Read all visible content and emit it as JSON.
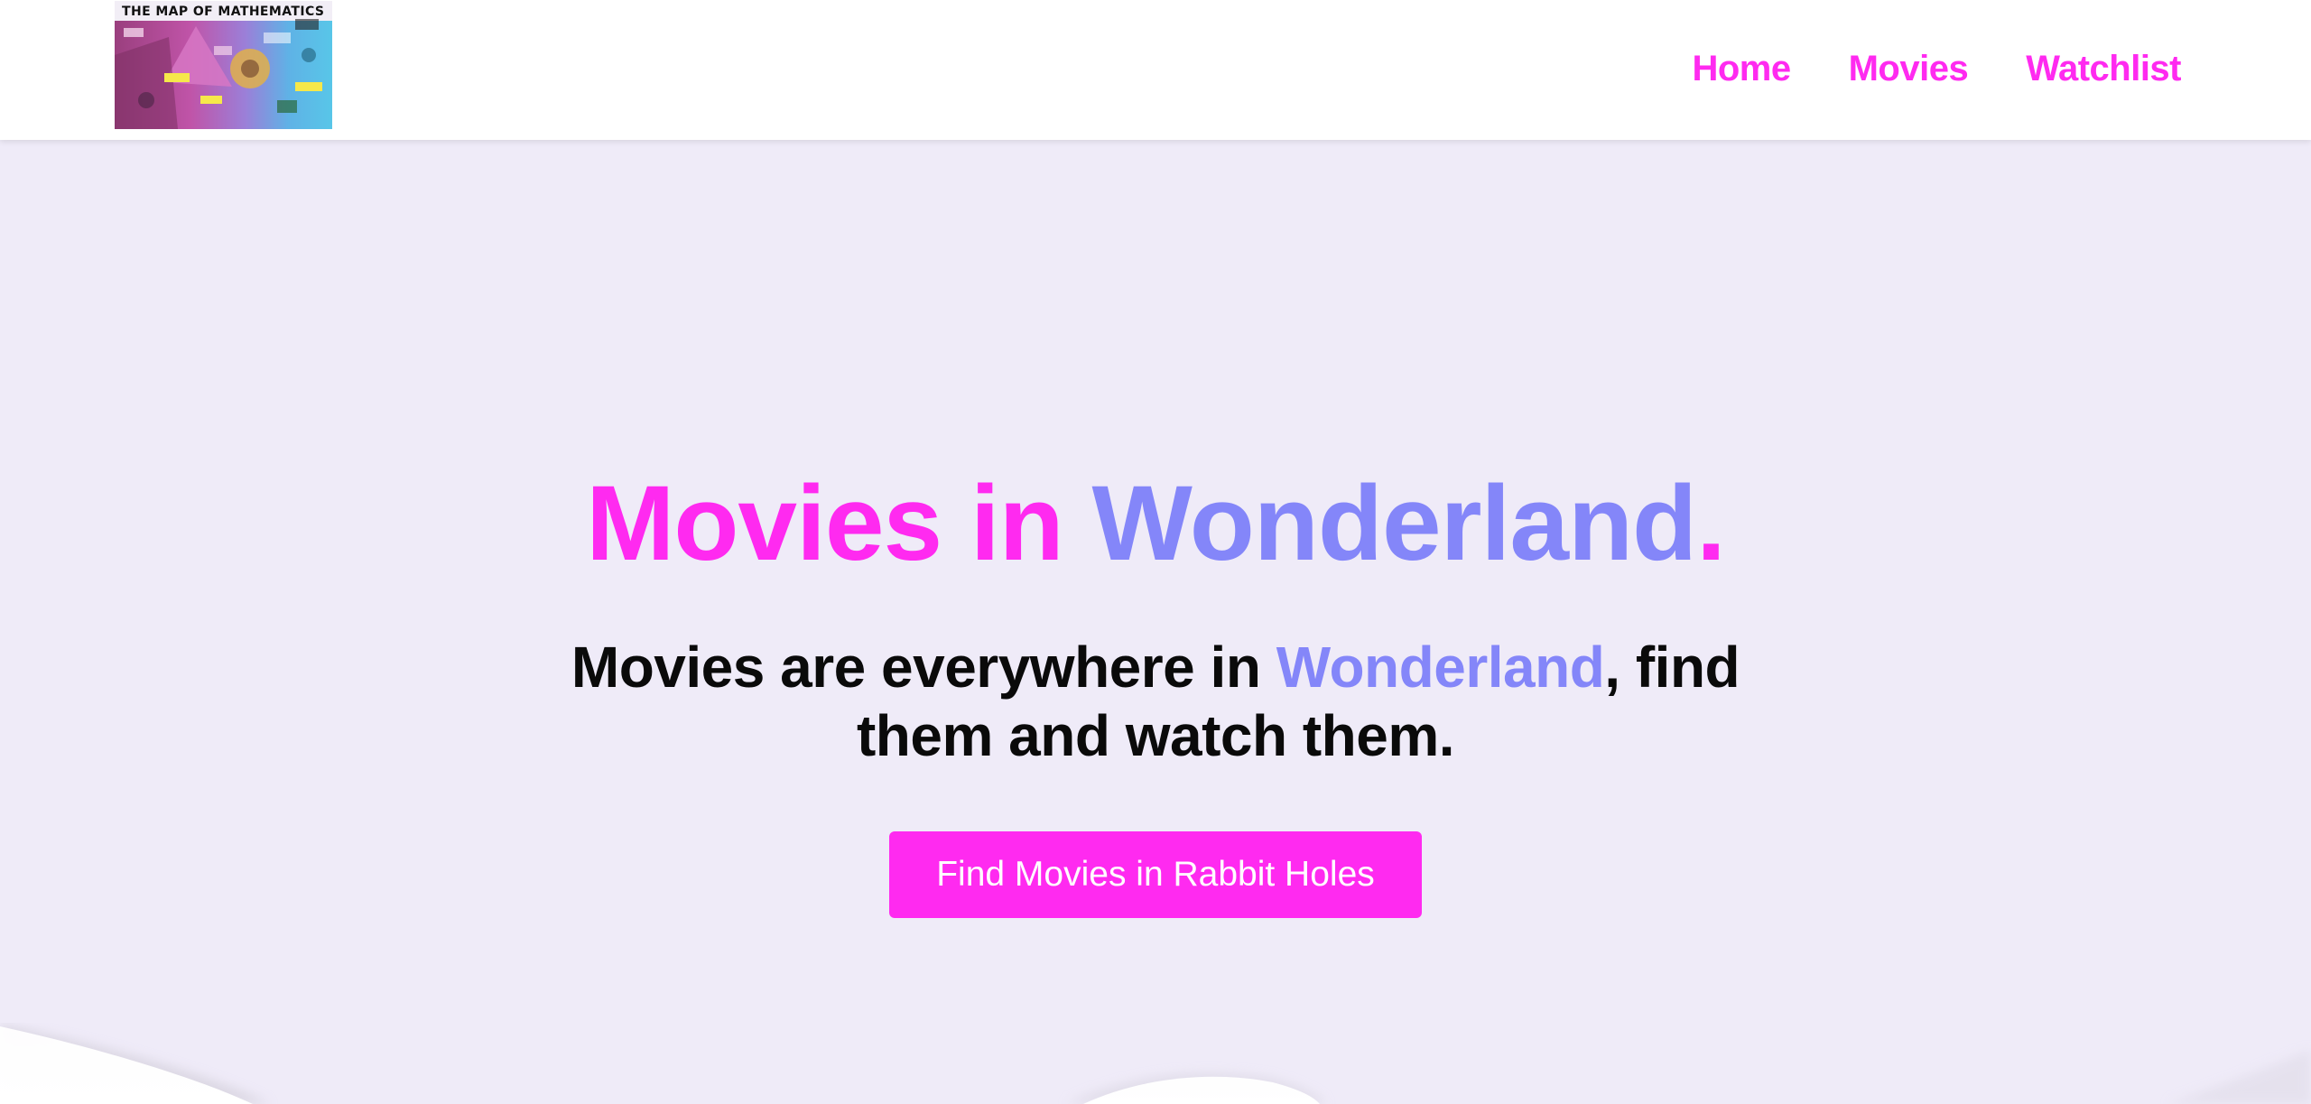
{
  "colors": {
    "accent_pink": "#ff2af0",
    "accent_periwinkle": "#8486f9",
    "background": "#efebf8",
    "navbar_bg": "#ffffff",
    "text_dark": "#0a0a0a",
    "button_text": "#ffffff"
  },
  "navbar": {
    "logo_title": "THE MAP OF MATHEMATICS",
    "links": [
      {
        "label": "Home"
      },
      {
        "label": "Movies"
      },
      {
        "label": "Watchlist"
      }
    ]
  },
  "hero": {
    "title_part1": "Movies in ",
    "title_part2": "Wonderland",
    "title_part3": ".",
    "subtitle_part1": "Movies are everywhere in ",
    "subtitle_highlight": "Wonderland",
    "subtitle_part2": ", find them and watch them.",
    "cta_label": "Find Movies in Rabbit Holes"
  }
}
